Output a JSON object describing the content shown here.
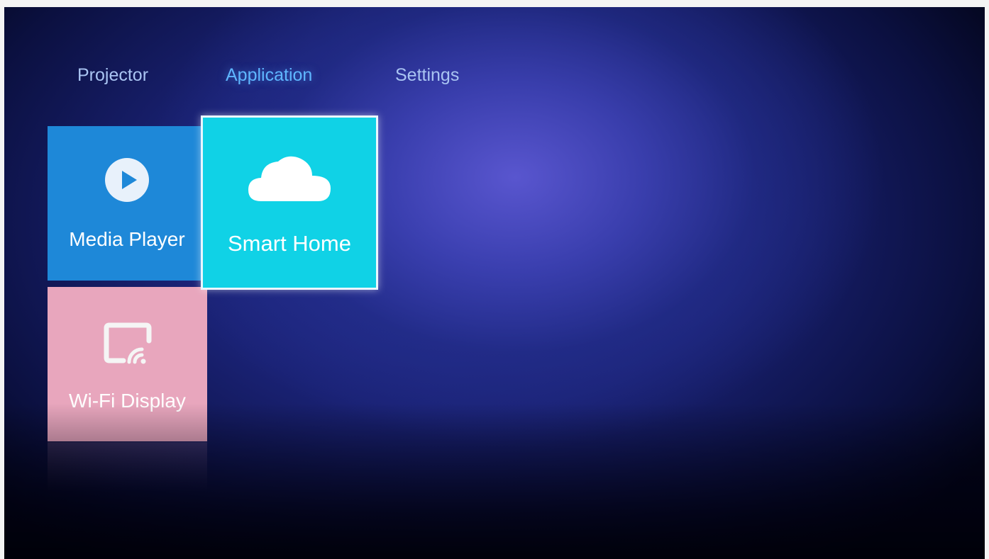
{
  "nav": {
    "tabs": [
      {
        "label": "Projector",
        "active": false
      },
      {
        "label": "Application",
        "active": true
      },
      {
        "label": "Settings",
        "active": false
      }
    ]
  },
  "tiles": {
    "media_player": {
      "label": "Media Player",
      "icon": "play-circle-icon",
      "color": "#1e88d8"
    },
    "smart_home": {
      "label": "Smart Home",
      "icon": "cloud-icon",
      "color": "#10d2e6",
      "focused": true
    },
    "wifi_display": {
      "label": "Wi-Fi Display",
      "icon": "cast-screen-icon",
      "color": "#e8a6bd"
    }
  },
  "colors": {
    "background": "#1a2275",
    "active_tab": "#5fb6ff",
    "inactive_tab": "#a9c4f2",
    "focus_border": "#eaf6ff"
  }
}
